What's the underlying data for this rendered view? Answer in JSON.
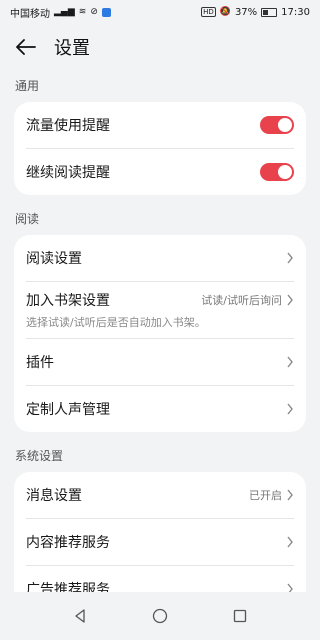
{
  "status": {
    "carrier": "中国移动",
    "battery": "37%",
    "time": "17:30",
    "hd": "HD"
  },
  "header": {
    "title": "设置"
  },
  "sections": {
    "general": {
      "label": "通用",
      "items": [
        {
          "title": "流量使用提醒",
          "toggle": true
        },
        {
          "title": "继续阅读提醒",
          "toggle": true
        }
      ]
    },
    "reading": {
      "label": "阅读",
      "items": [
        {
          "title": "阅读设置"
        },
        {
          "title": "加入书架设置",
          "value": "试读/试听后询问",
          "subtitle": "选择试读/试听后是否自动加入书架。"
        },
        {
          "title": "插件"
        },
        {
          "title": "定制人声管理"
        }
      ]
    },
    "system": {
      "label": "系统设置",
      "items": [
        {
          "title": "消息设置",
          "value": "已开启"
        },
        {
          "title": "内容推荐服务"
        },
        {
          "title": "广告推荐服务"
        }
      ]
    }
  },
  "colors": {
    "toggle_on": "#e8424c",
    "background": "#f1f3f5"
  }
}
